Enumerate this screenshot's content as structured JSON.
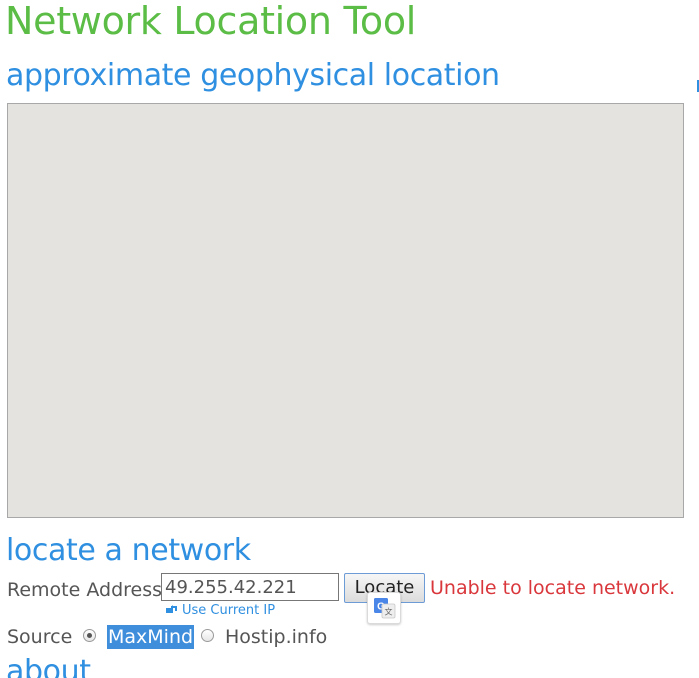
{
  "header": {
    "title": "Network Location Tool"
  },
  "geo_section": {
    "heading": "approximate geophysical location"
  },
  "locate_section": {
    "heading": "locate a network",
    "remote_address_label": "Remote Address",
    "remote_address_value": "49.255.42.221",
    "locate_button": "Locate",
    "error_message": "Unable to locate network.",
    "use_current_ip": "Use Current IP",
    "source_label": "Source",
    "sources": [
      {
        "label": "MaxMind",
        "selected": true
      },
      {
        "label": "Hostip.info",
        "selected": false
      }
    ]
  },
  "about_section": {
    "heading": "about"
  },
  "colors": {
    "title_green": "#5bbd45",
    "heading_blue": "#2f8fe0",
    "error_red": "#d9373b",
    "map_background": "#e5e3df",
    "selection_blue": "#3f8edc"
  },
  "icons": {
    "use_ip_icon": "refresh-arrow-icon",
    "translate_icon": "google-translate-icon"
  }
}
